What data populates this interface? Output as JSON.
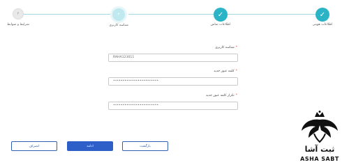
{
  "stepper": {
    "steps": [
      {
        "label": "اطلاعات هویتی",
        "status": "done",
        "marker": "✓"
      },
      {
        "label": "اطلاعات تماس",
        "status": "done",
        "marker": "✓"
      },
      {
        "label": "شناسه کاربری",
        "status": "current",
        "marker": "۳"
      },
      {
        "label": "شرایط و ضوابط",
        "status": "future",
        "marker": "۴"
      }
    ]
  },
  "form": {
    "username": {
      "label": "شناسه کاربری",
      "required": "*",
      "value": "RAHA123011"
    },
    "password": {
      "label": "کلمه عبور جدید",
      "required": "*",
      "value": "••••••••••••••••••••••••"
    },
    "password_repeat": {
      "label": "تکرار کلمه عبور جدید",
      "required": "*",
      "value": "••••••••••••••••••••••••"
    }
  },
  "buttons": {
    "cancel": "انصراف",
    "continue": "ادامه",
    "back": "بازگشت"
  },
  "watermark": {
    "text_fa": "ثبت آشا",
    "text_en": "ASHA SABT"
  },
  "colors": {
    "accent": "#2bb3c6",
    "primary": "#2e5fc9",
    "required": "#e53935"
  }
}
